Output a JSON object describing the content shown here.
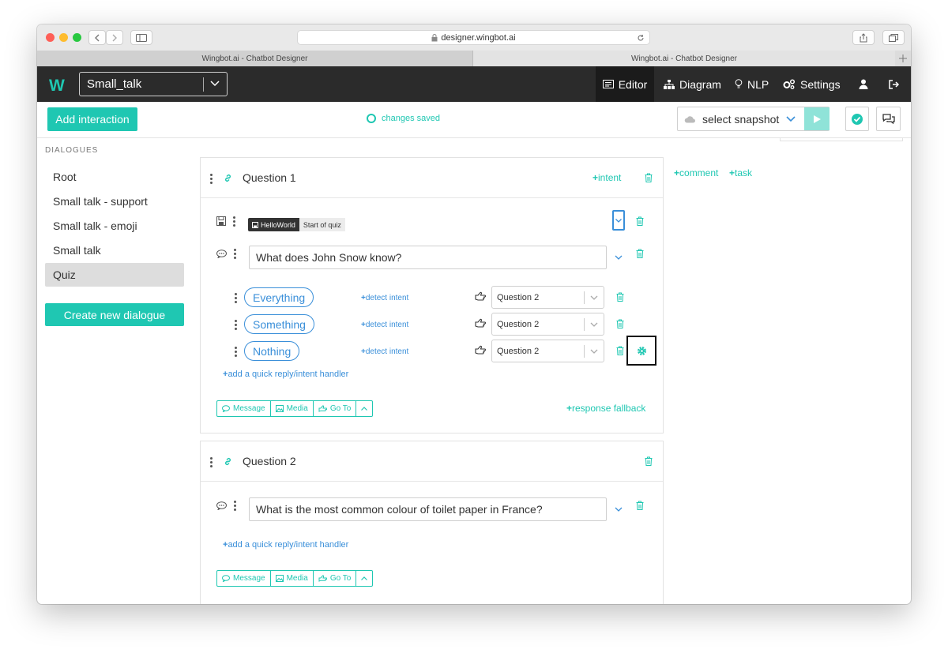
{
  "browser": {
    "url": "designer.wingbot.ai",
    "tabs": [
      "Wingbot.ai - Chatbot Designer",
      "Wingbot.ai - Chatbot Designer"
    ]
  },
  "header": {
    "logo": "W",
    "bot_name": "Small_talk",
    "nav": [
      {
        "label": "Editor",
        "icon": "editor-icon",
        "active": true
      },
      {
        "label": "Diagram",
        "icon": "diagram-icon"
      },
      {
        "label": "NLP",
        "icon": "lightbulb-icon"
      },
      {
        "label": "Settings",
        "icon": "gears-icon"
      }
    ]
  },
  "toolbar": {
    "add_interaction": "Add interaction",
    "status": "changes saved",
    "snapshot_select": "select snapshot"
  },
  "sidebar": {
    "heading": "DIALOGUES",
    "items": [
      "Root",
      "Small talk - support",
      "Small talk - emoji",
      "Small talk",
      "Quiz"
    ],
    "selected": "Quiz",
    "create_button": "Create new dialogue"
  },
  "right_panel": {
    "comment_label": "comment",
    "task_label": "task"
  },
  "question1": {
    "title": "Question 1",
    "intent_label": "intent",
    "tag": "HelloWorld",
    "tag_desc": "Start of quiz",
    "message": "What does John Snow know?",
    "replies": [
      {
        "label": "Everything",
        "detect": "detect intent",
        "target": "Question 2"
      },
      {
        "label": "Something",
        "detect": "detect intent",
        "target": "Question 2"
      },
      {
        "label": "Nothing",
        "detect": "detect intent",
        "target": "Question 2"
      }
    ],
    "add_handler": "add a quick reply/intent handler",
    "buttons": [
      "Message",
      "Media",
      "Go To"
    ],
    "fallback": "response fallback"
  },
  "question2": {
    "title": "Question 2",
    "message": "What is the most common colour of toilet paper in France?",
    "add_handler": "add a quick reply/intent handler",
    "buttons": [
      "Message",
      "Media",
      "Go To"
    ]
  },
  "colors": {
    "accent": "#1fc7b2",
    "link": "#3a8fd9",
    "header_bg": "#2b2b2b"
  }
}
